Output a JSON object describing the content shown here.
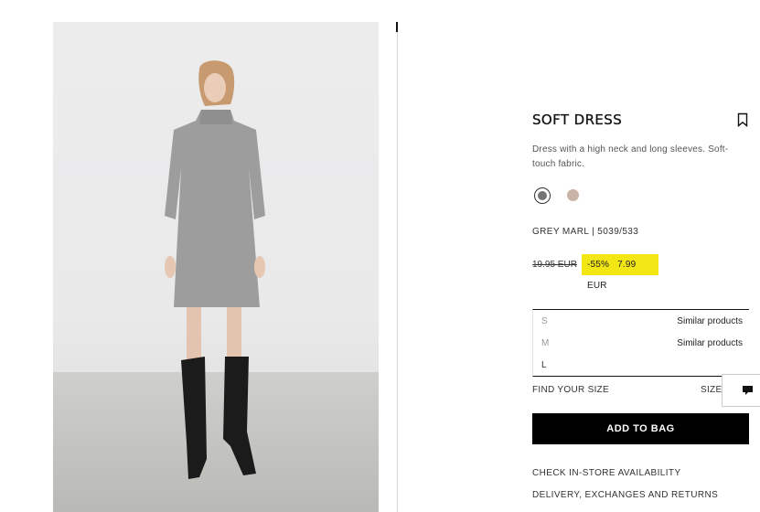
{
  "product": {
    "name": "SOFT DRESS",
    "description": "Dress with a high neck and long sleeves. Soft-touch fabric.",
    "color_ref": "GREY MARL | 5039/533",
    "original_price": "19.95 EUR",
    "discount": "-55%",
    "sale_price": "7.99 EUR",
    "colors": [
      {
        "name": "grey-marl",
        "hex": "#747474",
        "selected": true
      },
      {
        "name": "beige",
        "hex": "#c9b3a7",
        "selected": false
      }
    ],
    "image_alt": "model wearing grey high-neck dress with black knee-high boots"
  },
  "sizes": [
    {
      "label": "S",
      "note": "Similar products"
    },
    {
      "label": "M",
      "note": "Similar products"
    },
    {
      "label": "L",
      "note": ""
    }
  ],
  "actions": {
    "find_your_size": "FIND YOUR SIZE",
    "size_guide": "SIZE",
    "add_to_bag": "ADD TO BAG",
    "check_store": "CHECK IN-STORE AVAILABILITY",
    "delivery": "DELIVERY, EXCHANGES AND RETURNS"
  },
  "icons": {
    "bookmark": "bookmark-icon",
    "chat": "chat-icon"
  },
  "colors": {
    "sale_highlight": "#f2e614",
    "button": "#000000"
  }
}
